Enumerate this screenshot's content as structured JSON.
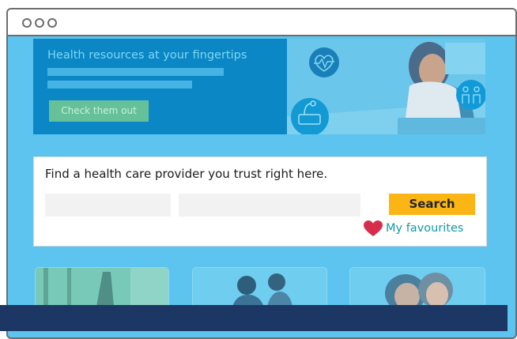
{
  "window": {
    "controls": [
      "window-dot",
      "window-dot",
      "window-dot"
    ]
  },
  "hero": {
    "title": "Health resources at your fingertips",
    "button_label": "Check them out",
    "icons": [
      "heartbeat-icon",
      "weight-scale-icon",
      "family-icon"
    ]
  },
  "search": {
    "title": "Find a health care provider you trust right here.",
    "field_1": {
      "value": "",
      "placeholder": ""
    },
    "field_2": {
      "value": "",
      "placeholder": ""
    },
    "button_label": "Search"
  },
  "favourites": {
    "label": "My favourites",
    "icon": "heart-icon"
  },
  "colors": {
    "page_bg": "#5cc4ee",
    "hero_bg": "#0a87c4",
    "hero_button": "#66c19a",
    "search_button": "#fbb515",
    "heart": "#d62e4a",
    "favourites_text": "#129aa8",
    "footer_bar": "#1c3764"
  }
}
